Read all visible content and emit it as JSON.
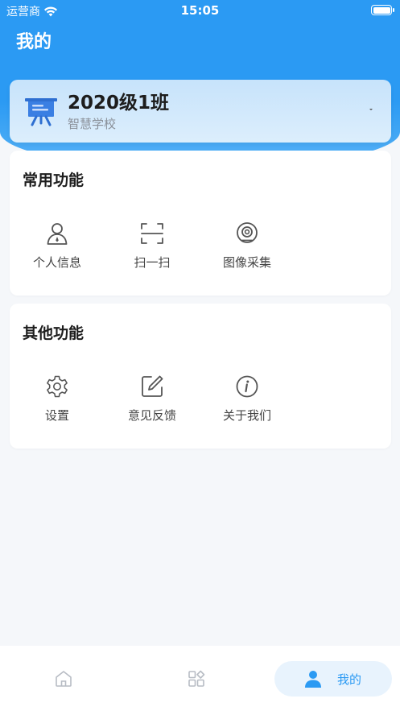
{
  "status_bar": {
    "carrier": "运营商",
    "time": "15:05"
  },
  "header": {
    "title": "我的"
  },
  "class_card": {
    "class_name": "2020级1班",
    "school": "智慧学校"
  },
  "sections": [
    {
      "title": "常用功能",
      "items": [
        {
          "label": "个人信息",
          "icon": "person-icon"
        },
        {
          "label": "扫一扫",
          "icon": "scan-icon"
        },
        {
          "label": "图像采集",
          "icon": "camera-icon"
        }
      ]
    },
    {
      "title": "其他功能",
      "items": [
        {
          "label": "设置",
          "icon": "gear-icon"
        },
        {
          "label": "意见反馈",
          "icon": "edit-icon"
        },
        {
          "label": "关于我们",
          "icon": "info-icon"
        }
      ]
    }
  ],
  "tab_bar": {
    "items": [
      {
        "icon": "home-icon",
        "label": ""
      },
      {
        "icon": "apps-icon",
        "label": ""
      },
      {
        "icon": "person-icon",
        "label": "我的",
        "active": true
      }
    ]
  },
  "colors": {
    "primary": "#2b9af3",
    "card_bg": "#dceefc",
    "page_bg": "#f5f7fa"
  }
}
